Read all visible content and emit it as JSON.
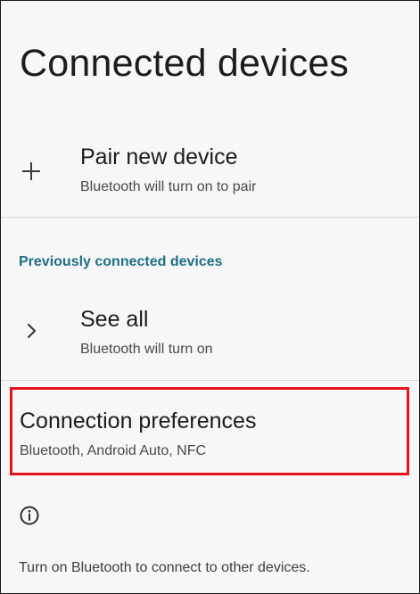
{
  "page": {
    "title": "Connected devices"
  },
  "pair_new_device": {
    "icon": "plus-icon",
    "title": "Pair new device",
    "summary": "Bluetooth will turn on to pair"
  },
  "previously_connected": {
    "header": "Previously connected devices",
    "see_all": {
      "icon": "chevron-right-icon",
      "title": "See all",
      "summary": "Bluetooth will turn on"
    }
  },
  "connection_preferences": {
    "title": "Connection preferences",
    "summary": "Bluetooth, Android Auto, NFC",
    "highlighted": true,
    "highlight_color": "#e8141c"
  },
  "footer": {
    "icon": "info-icon",
    "text": "Turn on Bluetooth to connect to other devices."
  },
  "colors": {
    "background": "#f7f7f9",
    "section_header": "#1f6f83",
    "divider": "#d6d6d8"
  }
}
